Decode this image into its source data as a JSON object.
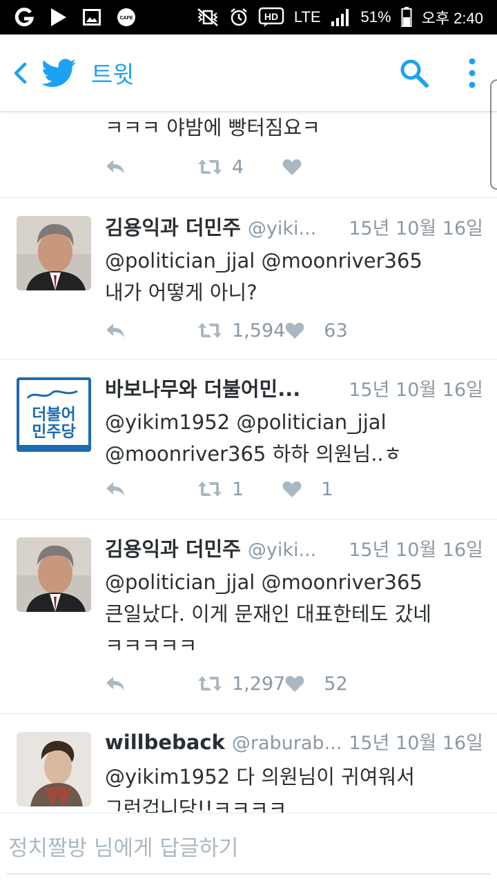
{
  "status_bar": {
    "network": "LTE",
    "battery": "51%",
    "time": "오후 2:40"
  },
  "app_bar": {
    "title": "트윗"
  },
  "colors": {
    "accent": "#1da1f2",
    "muted": "#8899a6",
    "text": "#292f33"
  },
  "tweets": [
    {
      "text_lines": [
        "ㅋㅋㅋ 야밤에 빵터짐요ㅋ"
      ],
      "retweets": "4",
      "likes": ""
    },
    {
      "name": "김용익과 더민주",
      "handle": "@yiki...",
      "date": "15년 10월 16일",
      "text_lines": [
        "@politician_jjal @moonriver365",
        "내가 어떻게 아니?"
      ],
      "retweets": "1,594",
      "likes": "63"
    },
    {
      "name": "바보나무와 더불어민...",
      "handle": "",
      "date": "15년 10월 16일",
      "text_lines": [
        "@yikim1952 @politician_jjal",
        "@moonriver365 하하 의원님..ㅎ"
      ],
      "retweets": "1",
      "likes": "1",
      "avatar_lines": [
        "더불어",
        "민주당"
      ]
    },
    {
      "name": "김용익과 더민주",
      "handle": "@yiki...",
      "date": "15년 10월 16일",
      "text_lines": [
        "@politician_jjal @moonriver365",
        "큰일났다. 이게 문재인 대표한테도 갔네",
        "ㅋㅋㅋㅋㅋ"
      ],
      "retweets": "1,297",
      "likes": "52"
    },
    {
      "name": "willbeback",
      "handle": "@raburab...",
      "date": "15년 10월 16일",
      "text_lines": [
        "@yikim1952 다 의원님이 귀여워서",
        "그런겁니당!!ㅋㅋㅋㅋ"
      ]
    }
  ],
  "composer": {
    "placeholder": "정치짤방 님에게 답글하기"
  }
}
